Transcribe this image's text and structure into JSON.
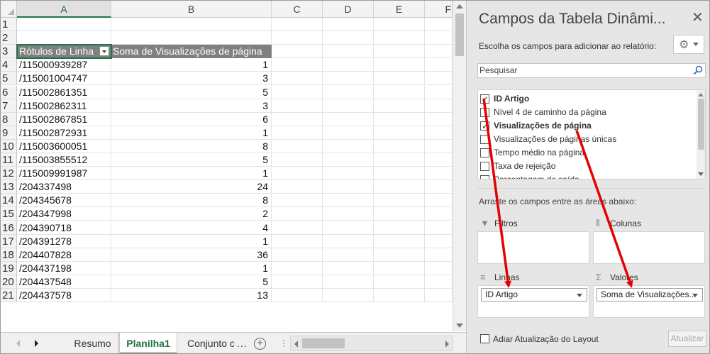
{
  "sheet": {
    "columns": [
      "A",
      "B",
      "C",
      "D",
      "E",
      "F"
    ],
    "rows": [
      {
        "num": "1",
        "a": "",
        "b": ""
      },
      {
        "num": "2",
        "a": "",
        "b": ""
      },
      {
        "num": "3",
        "a": "Rótulos de Linha",
        "b": "Soma de Visualizações de página"
      },
      {
        "num": "4",
        "a": "/115000939287",
        "b": "1"
      },
      {
        "num": "5",
        "a": "/115001004747",
        "b": "3"
      },
      {
        "num": "6",
        "a": "/115002861351",
        "b": "5"
      },
      {
        "num": "7",
        "a": "/115002862311",
        "b": "3"
      },
      {
        "num": "8",
        "a": "/115002867851",
        "b": "6"
      },
      {
        "num": "9",
        "a": "/115002872931",
        "b": "1"
      },
      {
        "num": "10",
        "a": "/115003600051",
        "b": "8"
      },
      {
        "num": "11",
        "a": "/115003855512",
        "b": "5"
      },
      {
        "num": "12",
        "a": "/115009991987",
        "b": "1"
      },
      {
        "num": "13",
        "a": "/204337498",
        "b": "24"
      },
      {
        "num": "14",
        "a": "/204345678",
        "b": "8"
      },
      {
        "num": "15",
        "a": "/204347998",
        "b": "2"
      },
      {
        "num": "16",
        "a": "/204390718",
        "b": "4"
      },
      {
        "num": "17",
        "a": "/204391278",
        "b": "1"
      },
      {
        "num": "18",
        "a": "/204407828",
        "b": "36"
      },
      {
        "num": "19",
        "a": "/204437198",
        "b": "1"
      },
      {
        "num": "20",
        "a": "/204437548",
        "b": "5"
      },
      {
        "num": "21",
        "a": "/204437578",
        "b": "13"
      }
    ],
    "tabs": {
      "tab1": "Resumo",
      "tab2": "Planilha1",
      "tab3": "Conjunto c",
      "more": "...",
      "add": "+",
      "dots": "⋮"
    }
  },
  "pane": {
    "title": "Campos da Tabela Dinâmi...",
    "close": "✕",
    "subtitle": "Escolha os campos para adicionar ao relatório:",
    "gear_icon": "gear-icon",
    "search_placeholder": "Pesquisar",
    "fields": [
      {
        "label": "ID Artigo",
        "checked": true,
        "bold": true
      },
      {
        "label": "Nível 4 de caminho da página",
        "checked": false,
        "bold": false
      },
      {
        "label": "Visualizações de página",
        "checked": true,
        "bold": true
      },
      {
        "label": "Visualizações de páginas únicas",
        "checked": false,
        "bold": false
      },
      {
        "label": "Tempo médio na página",
        "checked": false,
        "bold": false
      },
      {
        "label": "Taxa de rejeição",
        "checked": false,
        "bold": false
      },
      {
        "label": "Porcentagem de saída",
        "checked": false,
        "bold": false
      }
    ],
    "drag_hint": "Arraste os campos entre as áreas abaixo:",
    "areas": {
      "filters": {
        "label": "Filtros",
        "icon": "filter-icon"
      },
      "columns": {
        "label": "Colunas",
        "icon": "columns-icon"
      },
      "rows": {
        "label": "Linhas",
        "icon": "rows-icon",
        "value": "ID Artigo"
      },
      "values": {
        "label": "Valores",
        "icon": "sigma-icon",
        "value": "Soma de Visualizações..."
      }
    },
    "defer_label": "Adiar Atualização do Layout",
    "update_label": "Atualizar"
  },
  "colors": {
    "accent": "#217346",
    "annotation_arrow": "#e60000",
    "pivot_header": "#808080"
  }
}
